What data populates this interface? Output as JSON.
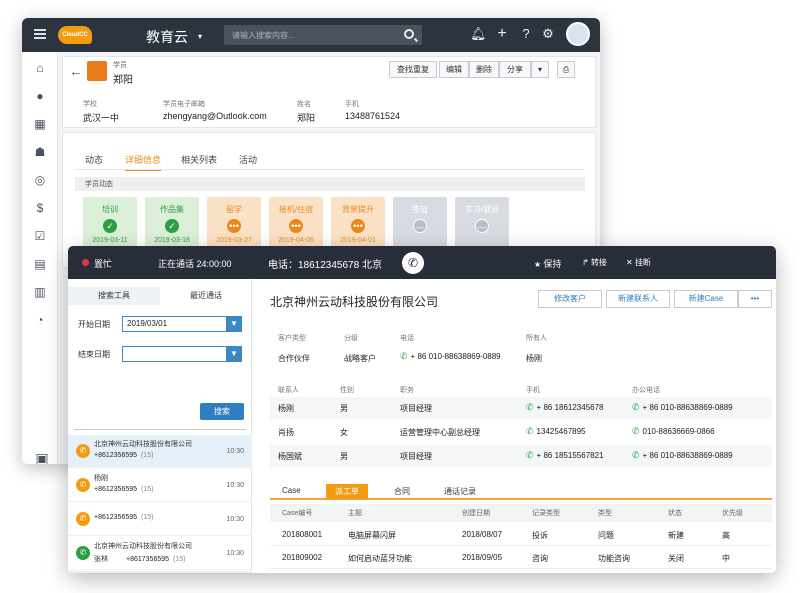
{
  "crm": {
    "app_title": "教育云",
    "app_caret": "▾",
    "logo_text": "CloudCC",
    "search_placeholder": "请输入搜索内容...",
    "record": {
      "type": "学员",
      "name": "郑阳",
      "buttons": [
        "查找重复",
        "编辑",
        "删除",
        "分享"
      ]
    },
    "fields": [
      {
        "label": "学校",
        "value": "武汉一中"
      },
      {
        "label": "学员电子邮箱",
        "value": "zhengyang@Outlook.com"
      },
      {
        "label": "姓名",
        "value": "郑阳"
      },
      {
        "label": "手机",
        "value": "13488761524"
      }
    ],
    "tabs": [
      "动态",
      "详细信息",
      "相关列表",
      "活动"
    ],
    "active_tab": "详细信息",
    "section_title": "学员动态",
    "stages": [
      {
        "label": "培训",
        "date": "2019-03-11",
        "status": "done"
      },
      {
        "label": "作品集",
        "date": "2019-03-18",
        "status": "done"
      },
      {
        "label": "留学",
        "date": "2019-03-27",
        "status": "progress"
      },
      {
        "label": "接机/住宿",
        "date": "2019-04-05",
        "status": "progress"
      },
      {
        "label": "背景提升",
        "date": "2019-04-01",
        "status": "progress"
      },
      {
        "label": "签证",
        "date": "",
        "status": "pending"
      },
      {
        "label": "实习/就业",
        "date": "",
        "status": "pending"
      }
    ]
  },
  "call": {
    "status": "置忙",
    "calling": "正在通话 24:00:00",
    "phone": "电话：18612345678  北京",
    "actions": [
      "保持",
      "转接",
      "挂断"
    ],
    "left_tabs": [
      "搜索工具",
      "最近通话"
    ],
    "start_label": "开始日期",
    "start_value": "2019/03/01",
    "end_label": "结束日期",
    "end_value": "",
    "search_button": "搜索",
    "calls": [
      {
        "name": "北京神州云动科技股份有限公司",
        "number": "+8612356595",
        "count": "(15)",
        "time": "10:30",
        "type": "orange"
      },
      {
        "name": "杨刚",
        "number": "+8612356595",
        "count": "(15)",
        "time": "10:30",
        "type": "orange"
      },
      {
        "name": "",
        "number": "+8612356595",
        "count": "(15)",
        "time": "10:30",
        "type": "orange"
      },
      {
        "name": "北京神州云动科技股份有限公司",
        "person": "张林",
        "number": "+8617356595",
        "count": "(15)",
        "time": "10:30",
        "type": "green"
      },
      {
        "name": "北京神州云动科技股份有限公司",
        "person": "王杰",
        "number": "+8612356595",
        "count": "(15)",
        "time": "10:30",
        "type": "green"
      }
    ],
    "company": "北京神州云动科技股份有限公司",
    "company_buttons": [
      "修改客户",
      "新建联系人",
      "新建Case",
      "•••"
    ],
    "info_labels": [
      "客户类型",
      "分级",
      "电话",
      "所有人"
    ],
    "info_values": [
      "合作伙伴",
      "战略客户",
      "+ 86 010-88638869-0889",
      "杨刚"
    ],
    "contact_headers": [
      "联系人",
      "性别",
      "职务",
      "手机",
      "办公电话"
    ],
    "contacts": [
      [
        "杨刚",
        "男",
        "项目经理",
        "+ 86 18612345678",
        "+ 86 010-88638869-0889"
      ],
      [
        "肖扬",
        "女",
        "运营管理中心副总经理",
        "13425467895",
        "010-88636669-0866"
      ],
      [
        "杨国斌",
        "男",
        "项目经理",
        "+ 86 18515567821",
        "+ 86 010-88638869-0889"
      ]
    ],
    "case_tabs": [
      "Case",
      "派工单",
      "合同",
      "通话记录"
    ],
    "case_active": "派工单",
    "case_headers": [
      "Case编号",
      "主题",
      "创建日期",
      "记录类型",
      "类型",
      "状态",
      "优先级"
    ],
    "cases": [
      [
        "201808001",
        "电脑屏幕闪屏",
        "2018/08/07",
        "投诉",
        "问题",
        "新建",
        "高"
      ],
      [
        "201809002",
        "如何启动蓝牙功能",
        "2018/09/05",
        "咨询",
        "功能咨询",
        "关闭",
        "中"
      ]
    ]
  },
  "colors": {
    "dark_bar": "#2c3440",
    "accent_orange": "#f39c12",
    "link_blue": "#2f7fc1",
    "done_green": "#2e9e44",
    "progress_orange": "#ea8a1b",
    "pending_gray": "#b8bec7"
  }
}
